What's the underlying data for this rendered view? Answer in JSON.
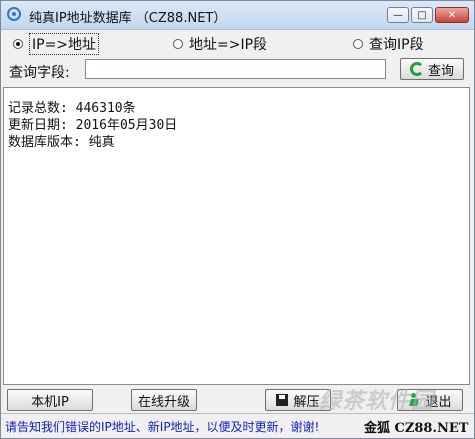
{
  "window": {
    "title": "纯真IP地址数据库 （CZ88.NET）",
    "controls": {
      "minimize": "—",
      "maximize": "□",
      "close": "✕"
    }
  },
  "modes": [
    {
      "label": "IP=>地址",
      "selected": true
    },
    {
      "label": "地址=>IP段",
      "selected": false
    },
    {
      "label": "查询IP段",
      "selected": false
    }
  ],
  "query": {
    "label": "查询字段:",
    "value": "",
    "button_label": "查询"
  },
  "output": {
    "lines": [
      "记录总数: 446310条",
      "更新日期: 2016年05月30日",
      "数据库版本: 纯真"
    ]
  },
  "buttons": {
    "local_ip": "本机IP",
    "online_upgrade": "在线升级",
    "unzip": "解压",
    "exit": "退出"
  },
  "status": {
    "message": "请告知我们错误的IP地址、新IP地址，以便及时更新，谢谢!",
    "brand": "金狐 CZ88.NET"
  },
  "watermark": "绿茶软件园"
}
